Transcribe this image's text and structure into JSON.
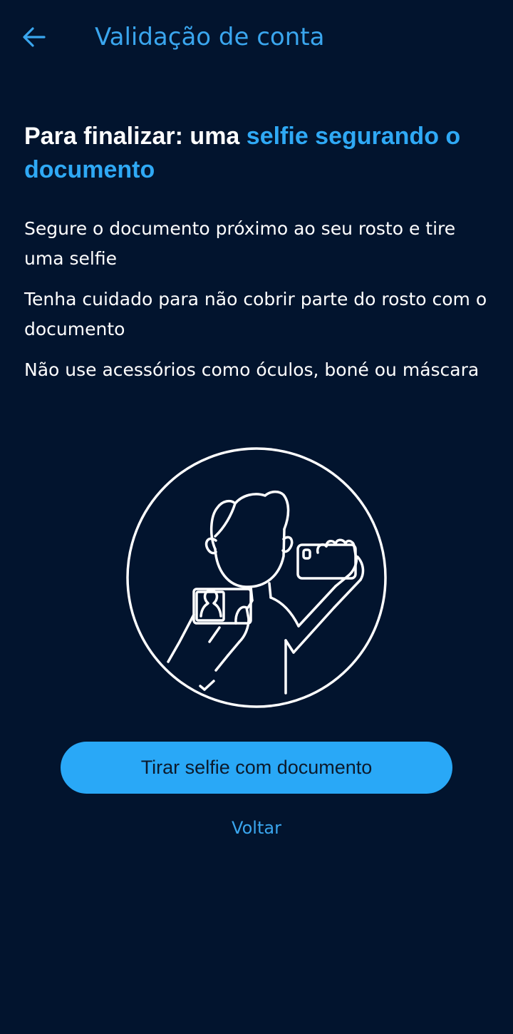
{
  "header": {
    "title": "Validação de conta",
    "back_icon": "arrow-left-icon"
  },
  "headline": {
    "prefix": "Para finalizar: uma ",
    "highlight": "selfie segurando o documento"
  },
  "instructions": [
    "Segure o documento próximo ao seu rosto e tire uma selfie",
    "Tenha cuidado para não cobrir parte do rosto com o documento",
    "Não use acessórios como óculos, boné ou máscara"
  ],
  "illustration": {
    "icon": "selfie-with-document-illustration"
  },
  "actions": {
    "primary_label": "Tirar selfie com documento",
    "secondary_label": "Voltar"
  },
  "colors": {
    "background": "#02142e",
    "accent": "#2fa9f5",
    "button": "#29a8f7",
    "text": "#ffffff"
  }
}
